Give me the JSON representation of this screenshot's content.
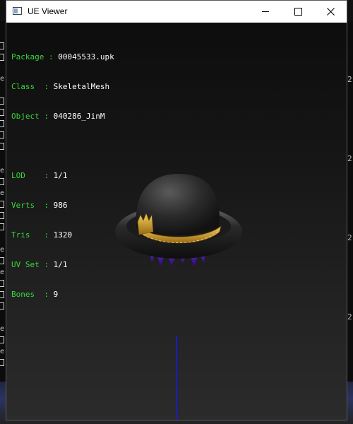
{
  "window": {
    "title": "UE Viewer",
    "controls": {
      "minimize": "minimize",
      "maximize": "maximize",
      "close": "close"
    }
  },
  "overlay": {
    "package": {
      "key": "Package",
      "value": "00045533.upk"
    },
    "class": {
      "key": "Class  ",
      "value": "SkeletalMesh"
    },
    "object": {
      "key": "Object ",
      "value": "040286_JinM"
    },
    "lod": {
      "key": "LOD    ",
      "value": "1/1"
    },
    "verts": {
      "key": "Verts  ",
      "value": "986"
    },
    "tris": {
      "key": "Tris   ",
      "value": "1320"
    },
    "uvset": {
      "key": "UV Set ",
      "value": "1/1"
    },
    "bones": {
      "key": "Bones  ",
      "value": "9"
    }
  },
  "background": {
    "left_marks": [
      "e",
      "e",
      "e",
      "e",
      "e",
      "e",
      "e"
    ],
    "right_marks": [
      "2",
      "2",
      "2",
      "2"
    ]
  },
  "colors": {
    "label_green": "#3bd63b",
    "value_white": "#ffffff",
    "axis_blue": "#1a1ad0",
    "hat_black": "#2a2a2a",
    "hat_band_gold": "#c89a2a",
    "hair_purple": "#5a1fb0"
  }
}
